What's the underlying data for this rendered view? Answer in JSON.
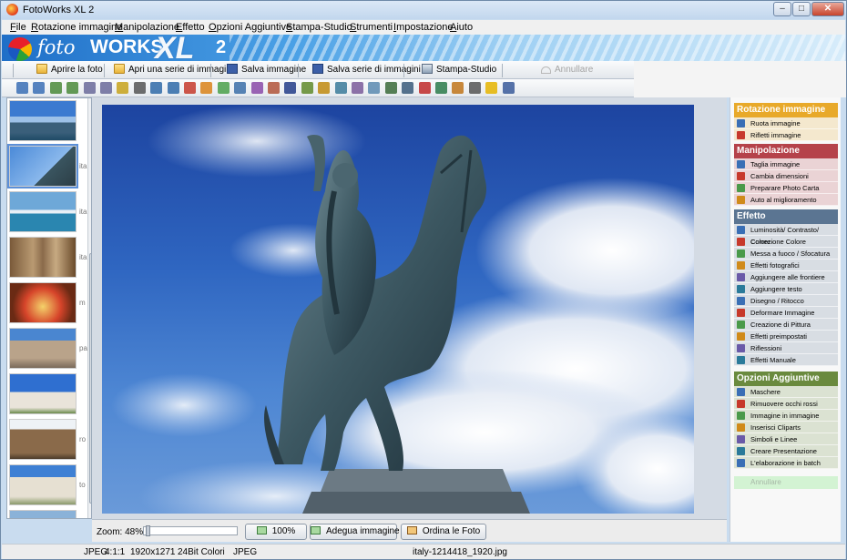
{
  "window": {
    "title": "FotoWorks XL 2"
  },
  "menu": [
    "File",
    "Rotazione immagine",
    "Manipolazione",
    "Effetto",
    "Opzioni Aggiuntive",
    "Stampa-Studio",
    "Strumenti",
    "Impostazione",
    "Aiuto"
  ],
  "logo": {
    "foto": "foto",
    "works": "WORKS",
    "xl": "XL",
    "version": "2"
  },
  "commands": {
    "open": "Aprire la foto",
    "open_series": "Apri una serie di immagini",
    "save": "Salva immagine",
    "save_series": "Salva serie di immagini",
    "print_studio": "Stampa-Studio",
    "undo": "Annullare"
  },
  "tool_icons": [
    "rotate-left-icon",
    "rotate-right-icon",
    "rotate-ccw-icon",
    "rotate-cw-icon",
    "flip-horizontal-icon",
    "flip-vertical-icon",
    "flash-icon",
    "cut-icon",
    "crop-icon",
    "resize-icon",
    "auto-enhance-icon",
    "levels-icon",
    "color-icon",
    "sharpen-icon",
    "photo-effects-icon",
    "frame-icon",
    "text-icon",
    "drawing-icon",
    "warp-icon",
    "paint-icon",
    "presets-icon",
    "reflection-icon",
    "manual-effects-icon",
    "mask-icon",
    "red-eye-icon",
    "picture-in-picture-icon",
    "clipart-icon",
    "symbol-icon",
    "star-icon",
    "batch-icon"
  ],
  "viewer": {
    "zoom_label": "Zoom: 48%",
    "zoom_value": 0.48,
    "btn_100": "100%",
    "btn_fit": "Adegua immagine",
    "btn_sort": "Ordina le Foto"
  },
  "status": {
    "format": "JPEG",
    "ratio": "4:1:1",
    "size": "1920x1271",
    "colors": "24Bit Colori",
    "type": "JPEG",
    "filename": "italy-1214418_1920.jpg"
  },
  "thumbnails": [
    {
      "name": "coast-thumb",
      "side": ""
    },
    {
      "name": "statue-thumb",
      "side": "ita"
    },
    {
      "name": "boats-thumb",
      "side": "ita"
    },
    {
      "name": "venice-thumb",
      "side": "ita"
    },
    {
      "name": "pizza-thumb",
      "side": "m"
    },
    {
      "name": "church-thumb",
      "side": "pa"
    },
    {
      "name": "pisa-thumb",
      "side": ""
    },
    {
      "name": "colosseum-thumb",
      "side": "ro"
    },
    {
      "name": "pisa-tower-thumb",
      "side": "to"
    },
    {
      "name": "landscape-thumb",
      "side": "vi"
    }
  ],
  "sidebar": {
    "rotation": {
      "title": "Rotazione immagine",
      "color": "#e8a92a",
      "items": [
        "Ruota immagine",
        "Rifletti immagine"
      ]
    },
    "manipulation": {
      "title": "Manipolazione",
      "color": "#b5424a",
      "items": [
        "Taglia immagine",
        "Cambia dimensioni",
        "Preparare Photo Carta",
        "Auto al miglioramento"
      ]
    },
    "effect": {
      "title": "Effetto",
      "color": "#5b7592",
      "items": [
        "Luminosità/ Contrasto/ Colore",
        "Correzione Colore",
        "Messa a fuoco / Sfocatura",
        "Effetti fotografici",
        "Aggiungere alle frontiere",
        "Aggiungere testo",
        "Disegno / Ritocco",
        "Deformare Immagine",
        "Creazione di Pittura",
        "Effetti preimpostati",
        "Riflessioni",
        "Effetti Manuale"
      ]
    },
    "options": {
      "title": "Opzioni Aggiuntive",
      "color": "#6a8a3e",
      "items": [
        "Maschere",
        "Rimuovere occhi rossi",
        "Immagine in immagine",
        "Inserisci Cliparts",
        "Simboli e Linee",
        "Creare Presentazione",
        "L'elaborazione in batch"
      ]
    },
    "undo": "Annullare"
  }
}
